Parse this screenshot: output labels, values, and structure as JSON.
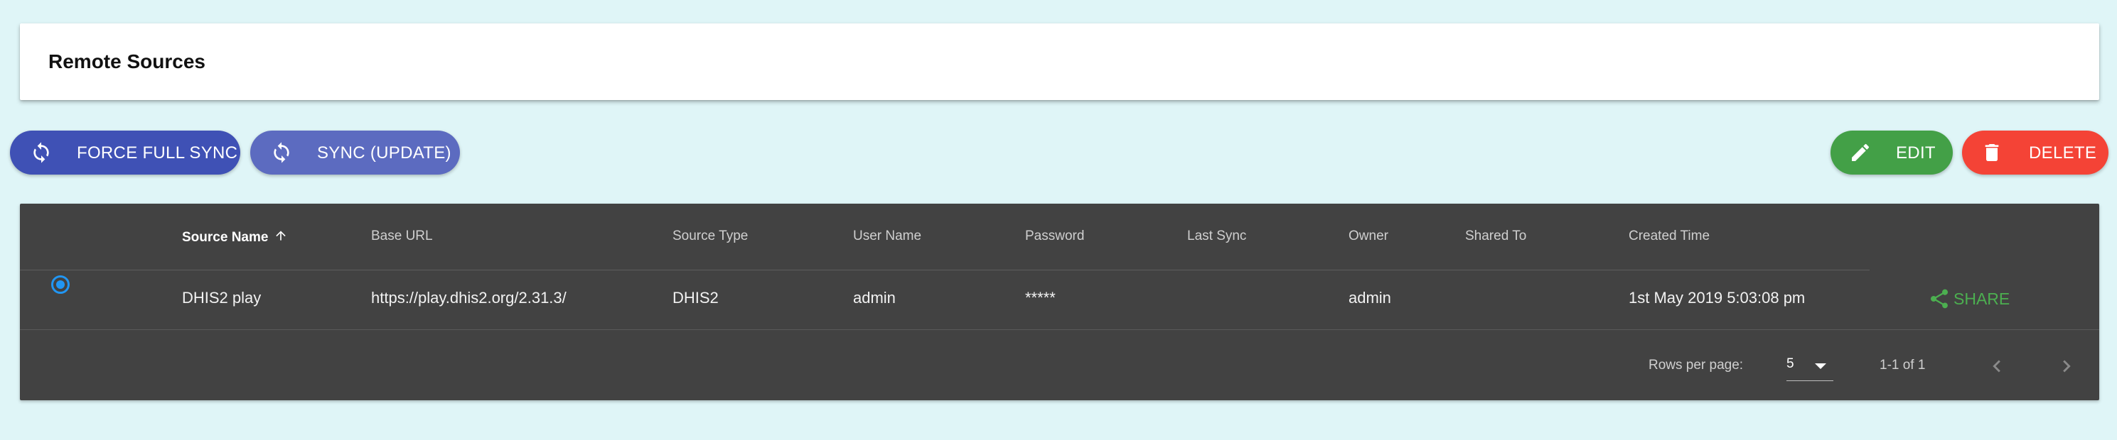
{
  "page": {
    "title": "Remote Sources"
  },
  "toolbar": {
    "force_full_sync_label": "FORCE FULL SYNC",
    "sync_update_label": "SYNC (UPDATE)",
    "edit_label": "EDIT",
    "delete_label": "DELETE"
  },
  "colors": {
    "background": "#dff5f7",
    "force_sync_button": "#3f51b5",
    "sync_update_button": "#5c6bc0",
    "edit_button": "#43a047",
    "delete_button": "#f44336",
    "table_background": "#424242",
    "share_link": "#4caf50",
    "radio_selected": "#2196f3"
  },
  "table": {
    "columns": [
      "Source Name",
      "Base URL",
      "Source Type",
      "User Name",
      "Password",
      "Last Sync",
      "Owner",
      "Shared To",
      "Created Time"
    ],
    "sorted_column": "Source Name",
    "sort_direction": "ascending",
    "rows": [
      {
        "selected": true,
        "source_name": "DHIS2 play",
        "base_url": "https://play.dhis2.org/2.31.3/",
        "source_type": "DHIS2",
        "user_name": "admin",
        "password": "*****",
        "last_sync": "",
        "owner": "admin",
        "shared_to": "",
        "created_time": "1st May 2019 5:03:08 pm",
        "action_label": "SHARE"
      }
    ],
    "footer": {
      "rows_per_page_label": "Rows per page:",
      "rows_per_page_value": "5",
      "range_label": "1-1 of 1"
    }
  },
  "icons": {
    "force_sync": "sync-icon",
    "sync_update": "sync-icon",
    "edit": "pencil-icon",
    "delete": "trash-icon",
    "share": "share-icon",
    "sort": "arrow-up-icon",
    "dropdown": "caret-down-icon",
    "prev_page": "chevron-left-icon",
    "next_page": "chevron-right-icon"
  }
}
